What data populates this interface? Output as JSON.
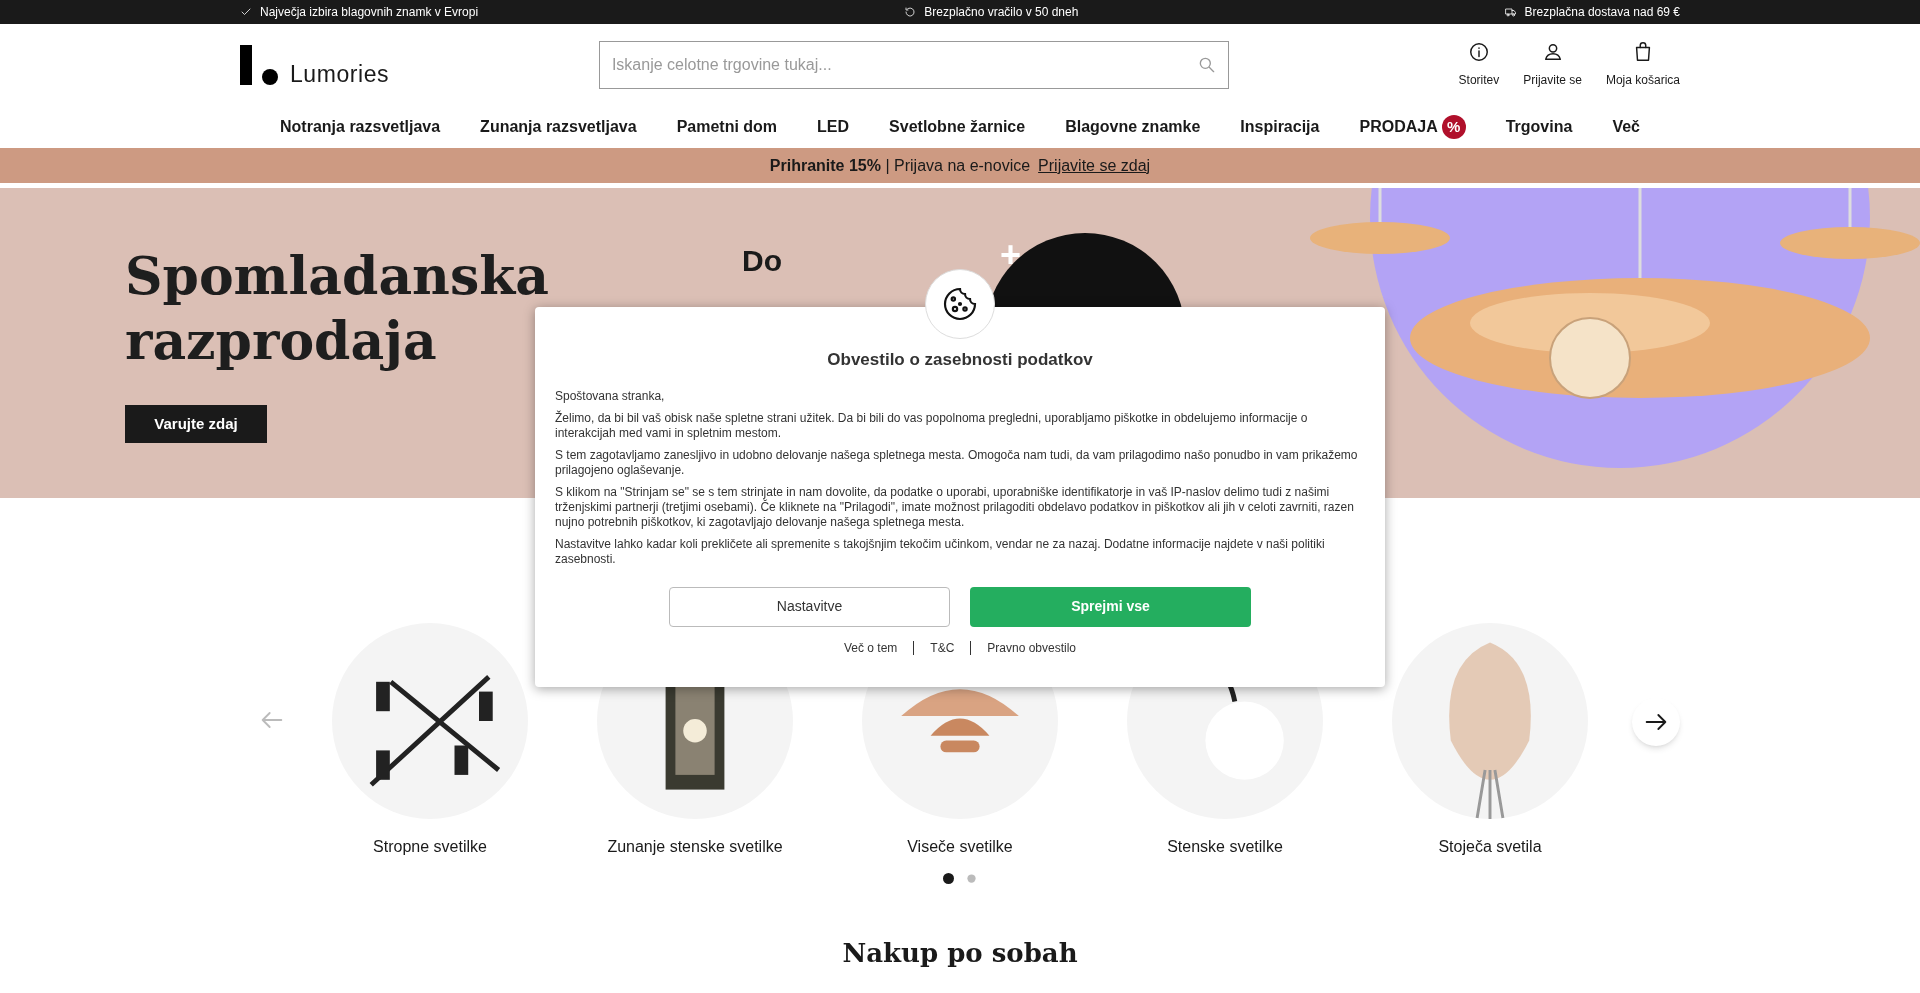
{
  "top_bar": [
    {
      "text": "Največja izbira blagovnih znamk v Evropi"
    },
    {
      "text": "Brezplačno vračilo v 50 dneh"
    },
    {
      "text": "Brezplačna dostava nad 69 €"
    }
  ],
  "header": {
    "logo": "Lumories",
    "search": {
      "placeholder": "Iskanje celotne trgovine tukaj..."
    },
    "actions": [
      {
        "label": "Storitev"
      },
      {
        "label": "Prijavite se"
      },
      {
        "label": "Moja košarica"
      }
    ]
  },
  "nav": [
    {
      "label": "Notranja razsvetljava"
    },
    {
      "label": "Zunanja razsvetljava"
    },
    {
      "label": "Pametni dom"
    },
    {
      "label": "LED"
    },
    {
      "label": "Svetlobne žarnice"
    },
    {
      "label": "Blagovne znamke"
    },
    {
      "label": "Inspiracija"
    },
    {
      "label": "PRODAJA",
      "badge": "%"
    },
    {
      "label": "Trgovina"
    },
    {
      "label": "Več"
    }
  ],
  "promo": {
    "text": "**Prihranite 15%** | Prijava na e-novice",
    "link": "Prijavite se zdaj"
  },
  "hero": {
    "title": "Spomladanska razprodaja",
    "button": "Varujte zdaj",
    "offer_prefix": "Do",
    "offer_plus": "+"
  },
  "categories": {
    "items": [
      {
        "kind": "ceiling",
        "label": "Stropne svetilke"
      },
      {
        "kind": "lantern",
        "label": "Zunanje stenske svetilke"
      },
      {
        "kind": "pendant",
        "label": "Viseče svetilke"
      },
      {
        "kind": "wall",
        "label": "Stenske svetilke"
      },
      {
        "kind": "floor",
        "label": "Stoječa svetila"
      }
    ],
    "dots": [
      {
        "selected": true
      },
      {
        "selected": false
      }
    ]
  },
  "section_title": "Nakup po sobah",
  "cookie_dialog": {
    "title": "Obvestilo o zasebnosti podatkov",
    "paragraphs": [
      "Spoštovana stranka,",
      "Želimo, da bi bil vaš obisk naše spletne strani užitek. Da bi bili do vas popolnoma pregledni, uporabljamo piškotke in obdelujemo informacije o interakcijah med vami in spletnim mestom.",
      "S tem zagotavljamo zanesljivo in udobno delovanje našega spletnega mesta. Omogoča nam tudi, da vam prilagodimo našo ponudbo in vam prikažemo prilagojeno oglaševanje.",
      "S klikom na \"Strinjam se\" se s tem strinjate in nam dovolite, da podatke o uporabi, uporabniške identifikatorje in vaš IP-naslov delimo tudi z našimi trženjskimi partnerji (tretjimi osebami). Če kliknete na \"Prilagodi\", imate možnost prilagoditi obdelavo podatkov in piškotkov ali jih v celoti zavrniti, razen nujno potrebnih piškotkov, ki zagotavljajo delovanje našega spletnega mesta.",
      "Nastavitve lahko kadar koli prekličete ali spremenite s takojšnjim tekočim učinkom, vendar ne za nazaj. Dodatne informacije najdete v naši politiki zasebnosti."
    ],
    "buttons": [
      {
        "kind": "secondary",
        "label": "Nastavitve"
      },
      {
        "kind": "primary",
        "label": "Sprejmi vse"
      }
    ],
    "links": [
      "Več o tem",
      "T&C",
      "Pravno obvestilo"
    ]
  }
}
